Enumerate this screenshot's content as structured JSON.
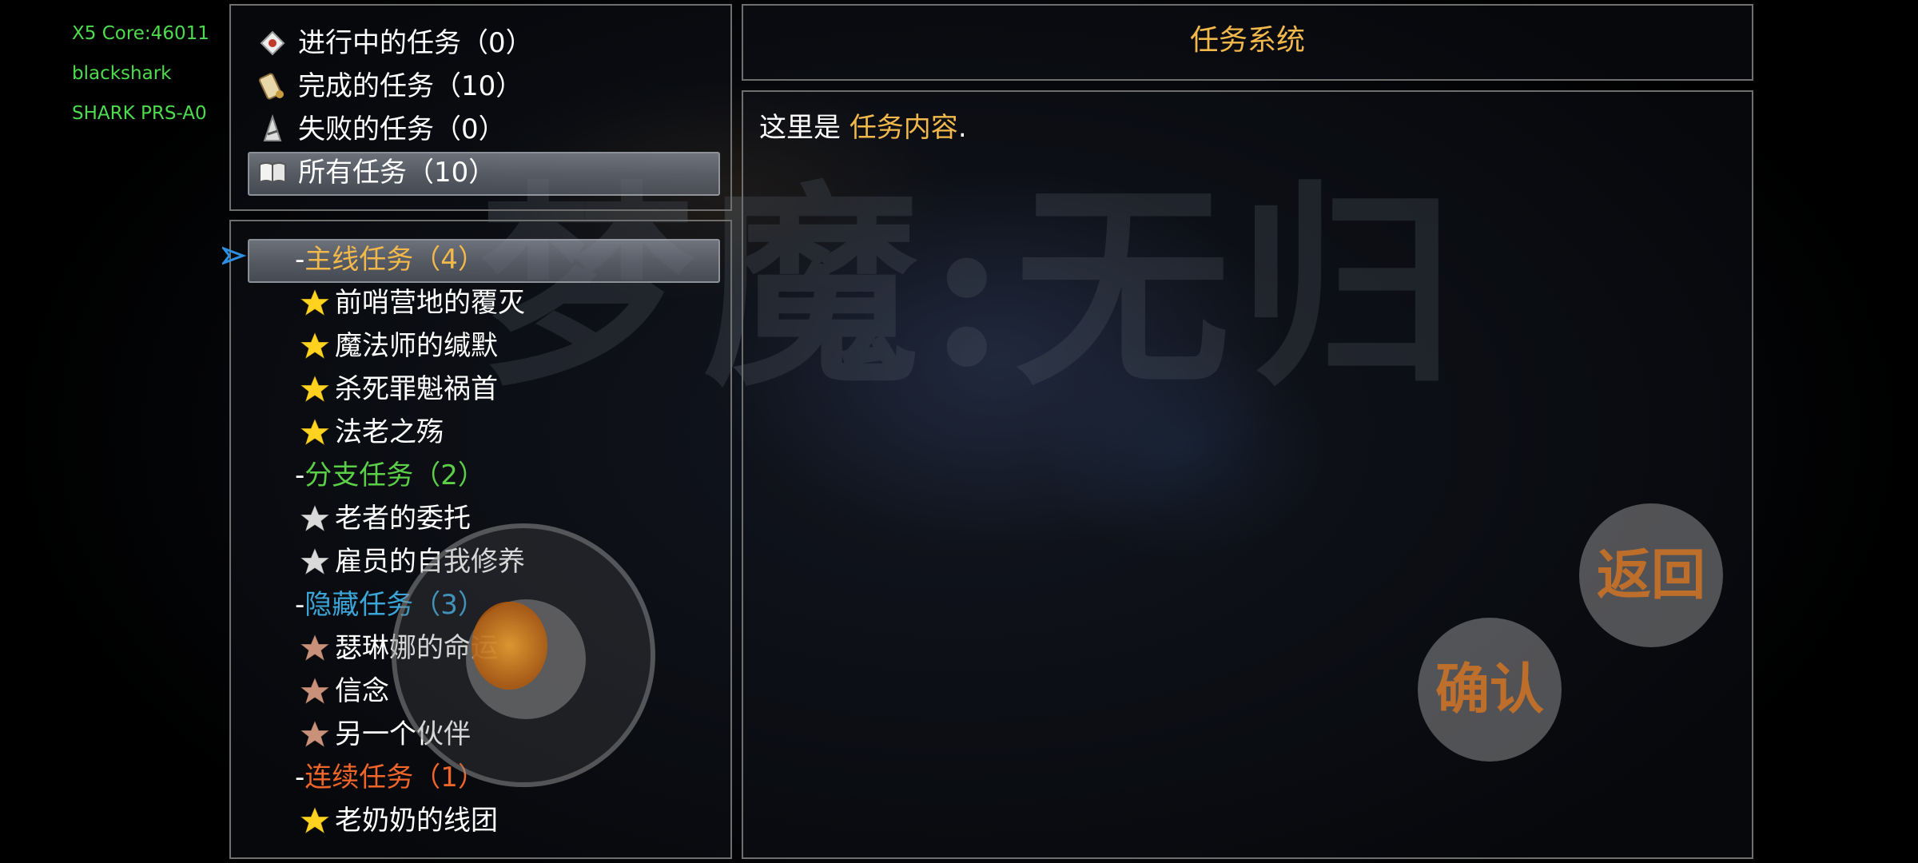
{
  "device_info": [
    "X5 Core:46011",
    "blackshark",
    "SHARK PRS-A0"
  ],
  "filters": [
    {
      "icon": "scroll-envelope-icon",
      "label": "进行中的任务（0）"
    },
    {
      "icon": "rolled-scroll-icon",
      "label": "完成的任务（10）"
    },
    {
      "icon": "broken-blade-icon",
      "label": "失败的任务（0）"
    },
    {
      "icon": "open-book-icon",
      "label": "所有任务（10）"
    }
  ],
  "selected_filter_index": 3,
  "quest_tree": [
    {
      "category": "-",
      "name": "主线任务（4）",
      "color": "#f2b84b",
      "star_color": "#ffd21f",
      "quests": [
        "前哨营地的覆灭",
        "魔法师的缄默",
        "杀死罪魁祸首",
        "法老之殇"
      ]
    },
    {
      "category": "-",
      "name": "分支任务（2）",
      "color": "#5ccf48",
      "star_color": "#d9d9d9",
      "quests": [
        "老者的委托",
        "雇员的自我修养"
      ]
    },
    {
      "category": "-",
      "name": "隐藏任务（3）",
      "color": "#3ba5d8",
      "star_color": "#c9907a",
      "quests": [
        "瑟琳娜的命运",
        "信念",
        "另一个伙伴"
      ]
    },
    {
      "category": "-",
      "name": "连续任务（1）",
      "color": "#f0652a",
      "star_color": "#ffd21f",
      "quests": [
        "老奶奶的线团"
      ]
    }
  ],
  "selected_category_index": 0,
  "title": "任务系统",
  "content": {
    "prefix": "这里是 ",
    "highlight": "任务内容",
    "suffix": "."
  },
  "background_title": "梦魔:无归",
  "buttons": {
    "back": "返回",
    "confirm": "确认"
  },
  "colors": {
    "title": "#f2b84b",
    "highlight": "#f2b84b",
    "device_info": "#4ddc4d"
  }
}
